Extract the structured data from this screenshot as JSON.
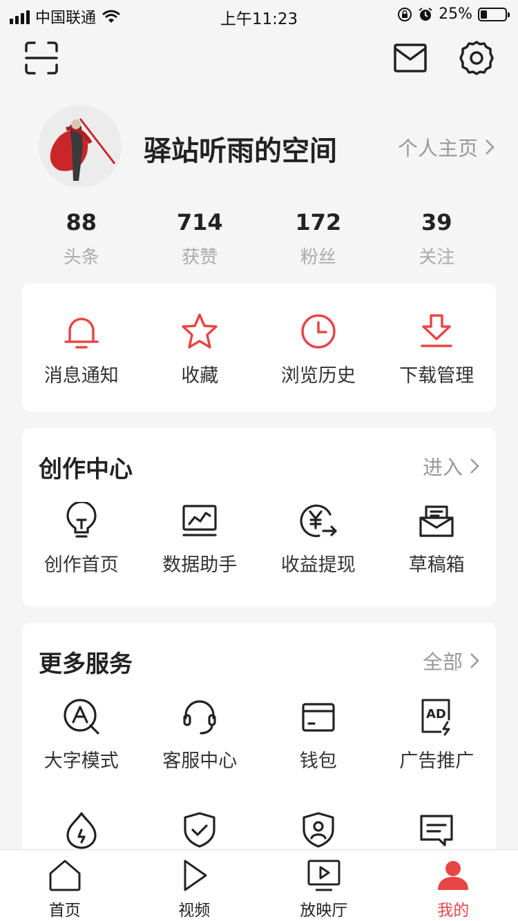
{
  "status_bar": {
    "carrier": "中国联通",
    "time": "上午11:23",
    "battery_text": "25%",
    "battery_level": 0.25
  },
  "header": {
    "scan_icon": "scan-icon",
    "mail_icon": "mail-icon",
    "settings_icon": "gear-icon"
  },
  "profile": {
    "username": "驿站听雨的空间",
    "homepage_label": "个人主页"
  },
  "stats": [
    {
      "value": "88",
      "label": "头条"
    },
    {
      "value": "714",
      "label": "获赞"
    },
    {
      "value": "172",
      "label": "粉丝"
    },
    {
      "value": "39",
      "label": "关注"
    }
  ],
  "quick_actions": [
    {
      "label": "消息通知",
      "icon": "bell-icon"
    },
    {
      "label": "收藏",
      "icon": "star-icon"
    },
    {
      "label": "浏览历史",
      "icon": "clock-icon"
    },
    {
      "label": "下载管理",
      "icon": "download-icon"
    }
  ],
  "creation_center": {
    "title": "创作中心",
    "link": "进入",
    "items": [
      {
        "label": "创作首页",
        "icon": "lightbulb-icon"
      },
      {
        "label": "数据助手",
        "icon": "chart-monitor-icon"
      },
      {
        "label": "收益提现",
        "icon": "yen-withdraw-icon"
      },
      {
        "label": "草稿箱",
        "icon": "draft-box-icon"
      }
    ]
  },
  "more_services": {
    "title": "更多服务",
    "link": "全部",
    "items": [
      {
        "label": "大字模式",
        "icon": "large-font-icon"
      },
      {
        "label": "客服中心",
        "icon": "headset-icon"
      },
      {
        "label": "钱包",
        "icon": "wallet-icon"
      },
      {
        "label": "广告推广",
        "icon": "ad-icon"
      }
    ],
    "partial_icons": [
      "flame-icon",
      "shield-check-icon",
      "user-shield-icon",
      "message-icon"
    ]
  },
  "tabbar": [
    {
      "label": "首页",
      "icon": "home-icon",
      "active": false
    },
    {
      "label": "视频",
      "icon": "play-icon",
      "active": false
    },
    {
      "label": "放映厅",
      "icon": "tv-play-icon",
      "active": false
    },
    {
      "label": "我的",
      "icon": "user-icon",
      "active": true
    }
  ],
  "colors": {
    "accent": "#e84545",
    "text": "#222222",
    "muted": "#999999",
    "background": "#f5f5f5"
  }
}
